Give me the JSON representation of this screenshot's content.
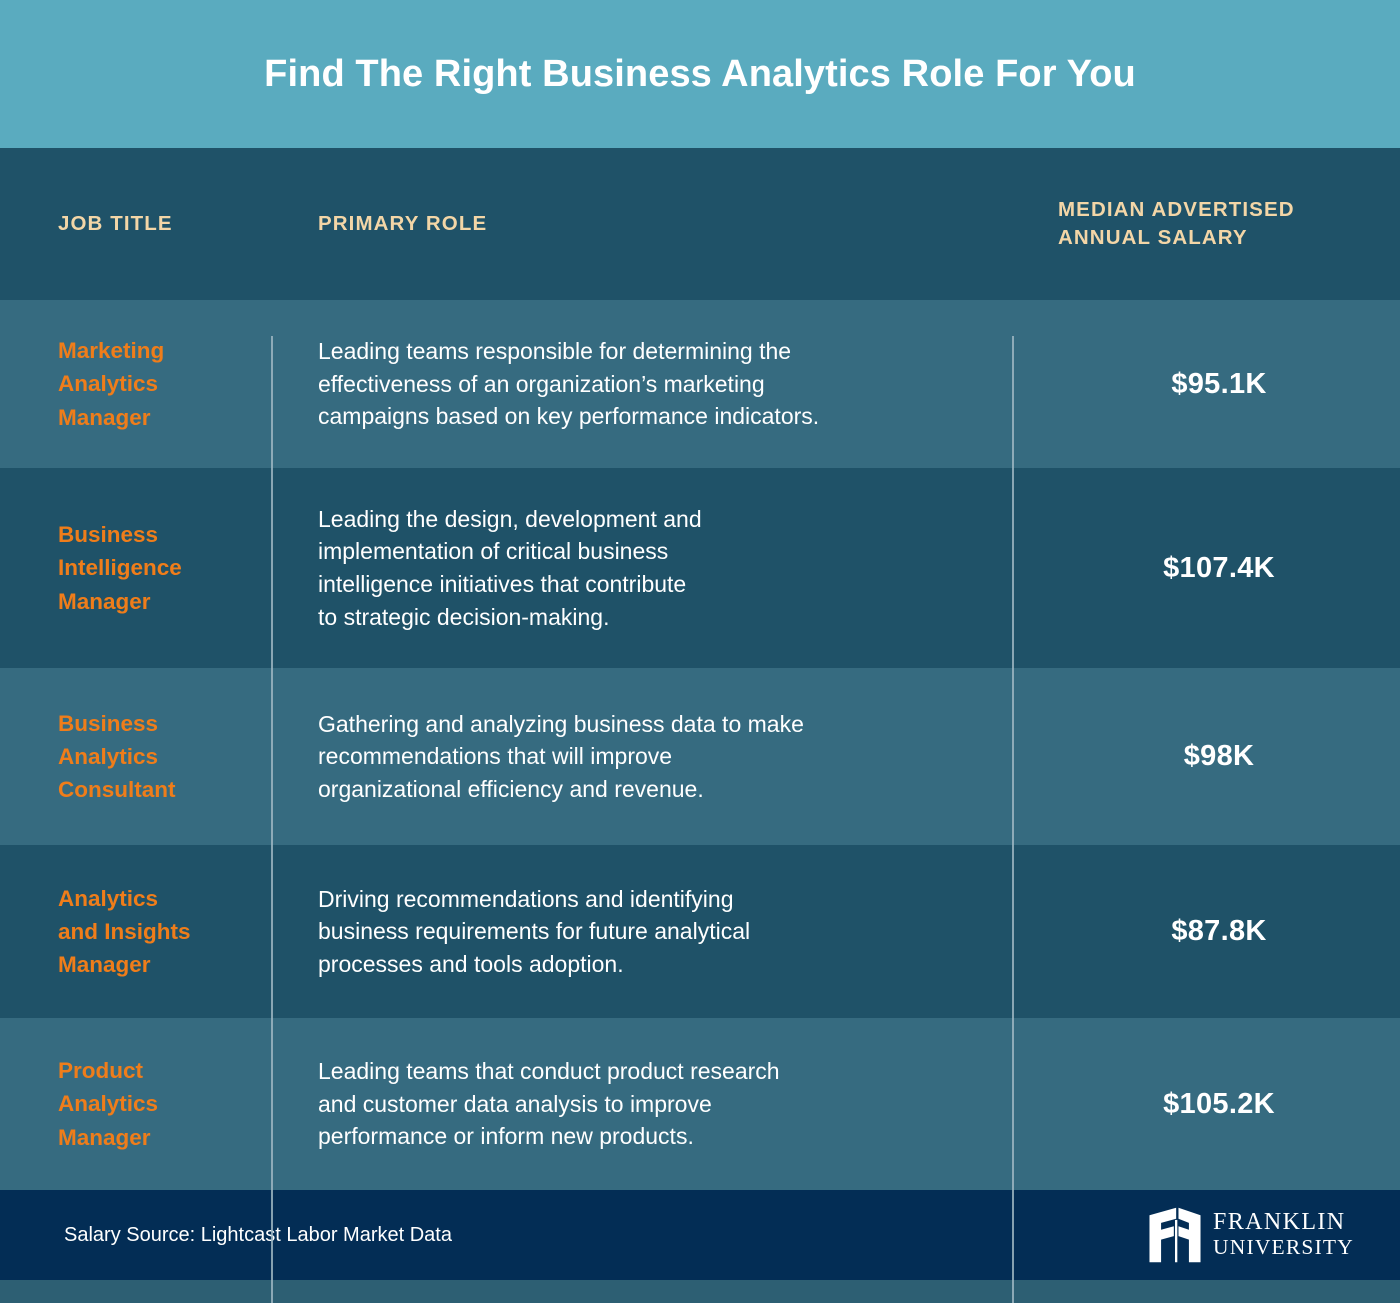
{
  "header": {
    "title": "Find The Right Business Analytics Role For You",
    "band_color": "#5aabbf"
  },
  "table": {
    "columns": [
      {
        "key": "job_title",
        "label": "JOB TITLE"
      },
      {
        "key": "primary_role",
        "label": "PRIMARY ROLE"
      },
      {
        "key": "salary",
        "label": "MEDIAN ADVERTISED\nANNUAL SALARY"
      }
    ],
    "column_label_color": "#f3d6a7",
    "job_title_color": "#ef7d1a",
    "row_colors": {
      "light": "#366b80",
      "dark": "#1f5268"
    },
    "rows": [
      {
        "job_title": "Marketing\nAnalytics\nManager",
        "primary_role": "Leading teams responsible for determining the\neffectiveness of an organization’s marketing\ncampaigns based on key performance indicators.",
        "salary": "$95.1K"
      },
      {
        "job_title": "Business\nIntelligence\nManager",
        "primary_role": "Leading the design, development and\nimplementation of critical business\nintelligence initiatives that contribute\nto strategic decision-making.",
        "salary": "$107.4K"
      },
      {
        "job_title": "Business\nAnalytics\nConsultant",
        "primary_role": "Gathering and analyzing business data to make\nrecommendations that will improve\norganizational efficiency and revenue.",
        "salary": "$98K"
      },
      {
        "job_title": "Analytics\nand Insights\nManager",
        "primary_role": "Driving recommendations and identifying\nbusiness requirements for future analytical\nprocesses and tools adoption.",
        "salary": "$87.8K"
      },
      {
        "job_title": "Product\nAnalytics\nManager",
        "primary_role": "Leading teams that conduct product research\nand customer data analysis to improve\nperformance or inform new products.",
        "salary": "$105.2K"
      }
    ]
  },
  "footer": {
    "source": "Salary Source: Lightcast Labor Market Data",
    "background_color": "#032d55",
    "logo": {
      "mark": "franklin-arch-icon",
      "line1": "FRANKLIN",
      "line2": "UNIVERSITY"
    }
  }
}
